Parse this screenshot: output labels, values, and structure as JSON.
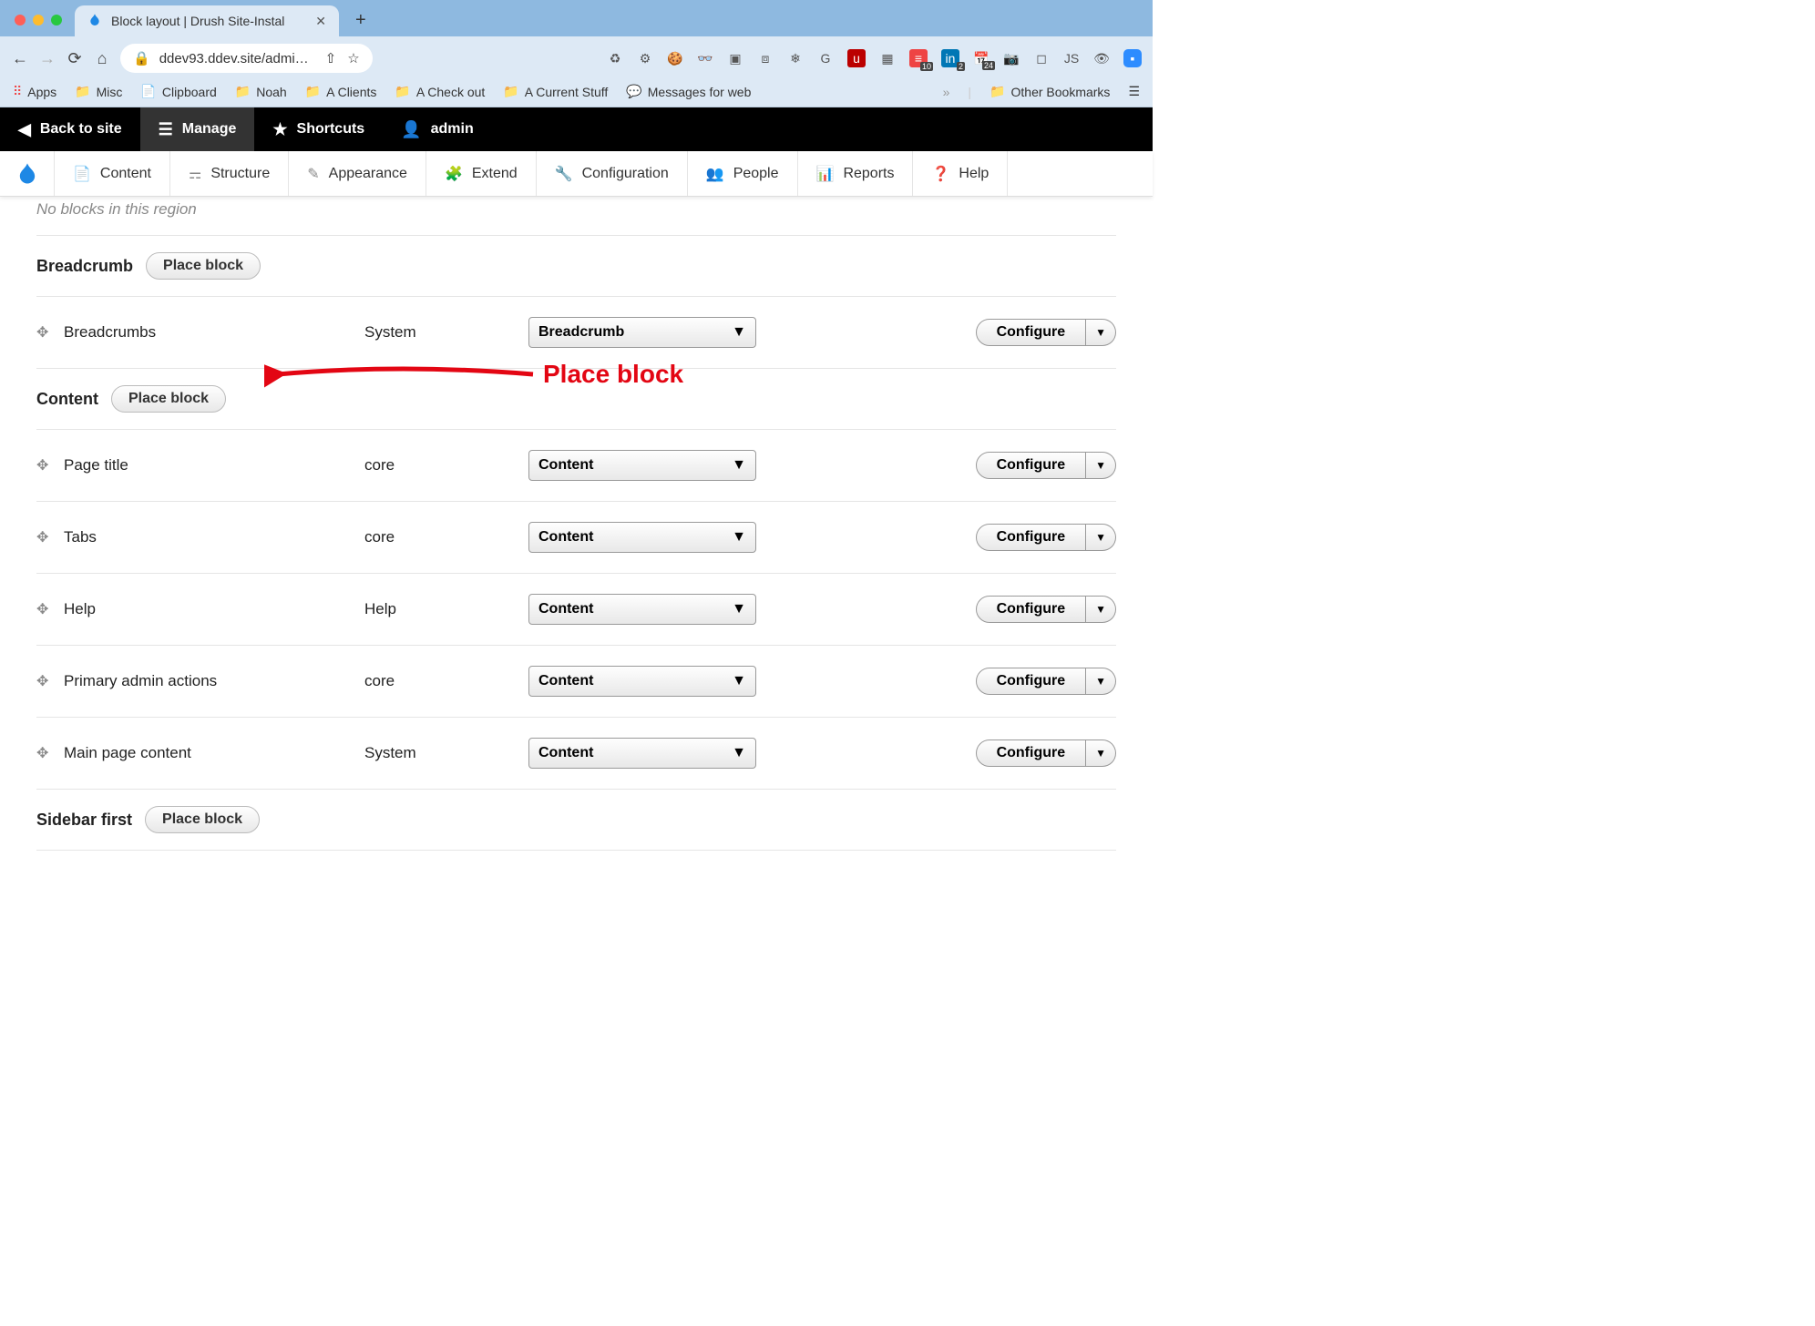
{
  "browser": {
    "tab_title": "Block layout | Drush Site-Instal",
    "url_display": "ddev93.ddev.site/admi…",
    "bookmarks": [
      "Apps",
      "Misc",
      "Clipboard",
      "Noah",
      "A Clients",
      "A Check out",
      "A Current Stuff",
      "Messages for web"
    ],
    "bookmarks_overflow": "»",
    "other_bookmarks": "Other Bookmarks",
    "ext_badge_1": "10",
    "ext_badge_2": "2",
    "ext_badge_3": "24"
  },
  "drupal_toolbar": {
    "back": "Back to site",
    "manage": "Manage",
    "shortcuts": "Shortcuts",
    "user": "admin"
  },
  "drupal_menu": [
    "Content",
    "Structure",
    "Appearance",
    "Extend",
    "Configuration",
    "People",
    "Reports",
    "Help"
  ],
  "no_blocks_text": "No blocks in this region",
  "place_block_label": "Place block",
  "configure_label": "Configure",
  "regions": [
    {
      "name": "Breadcrumb",
      "blocks": [
        {
          "name": "Breadcrumbs",
          "category": "System",
          "region": "Breadcrumb"
        }
      ]
    },
    {
      "name": "Content",
      "blocks": [
        {
          "name": "Page title",
          "category": "core",
          "region": "Content"
        },
        {
          "name": "Tabs",
          "category": "core",
          "region": "Content"
        },
        {
          "name": "Help",
          "category": "Help",
          "region": "Content"
        },
        {
          "name": "Primary admin actions",
          "category": "core",
          "region": "Content"
        },
        {
          "name": "Main page content",
          "category": "System",
          "region": "Content"
        }
      ]
    },
    {
      "name": "Sidebar first",
      "blocks": []
    }
  ],
  "annotation_text": "Place block"
}
